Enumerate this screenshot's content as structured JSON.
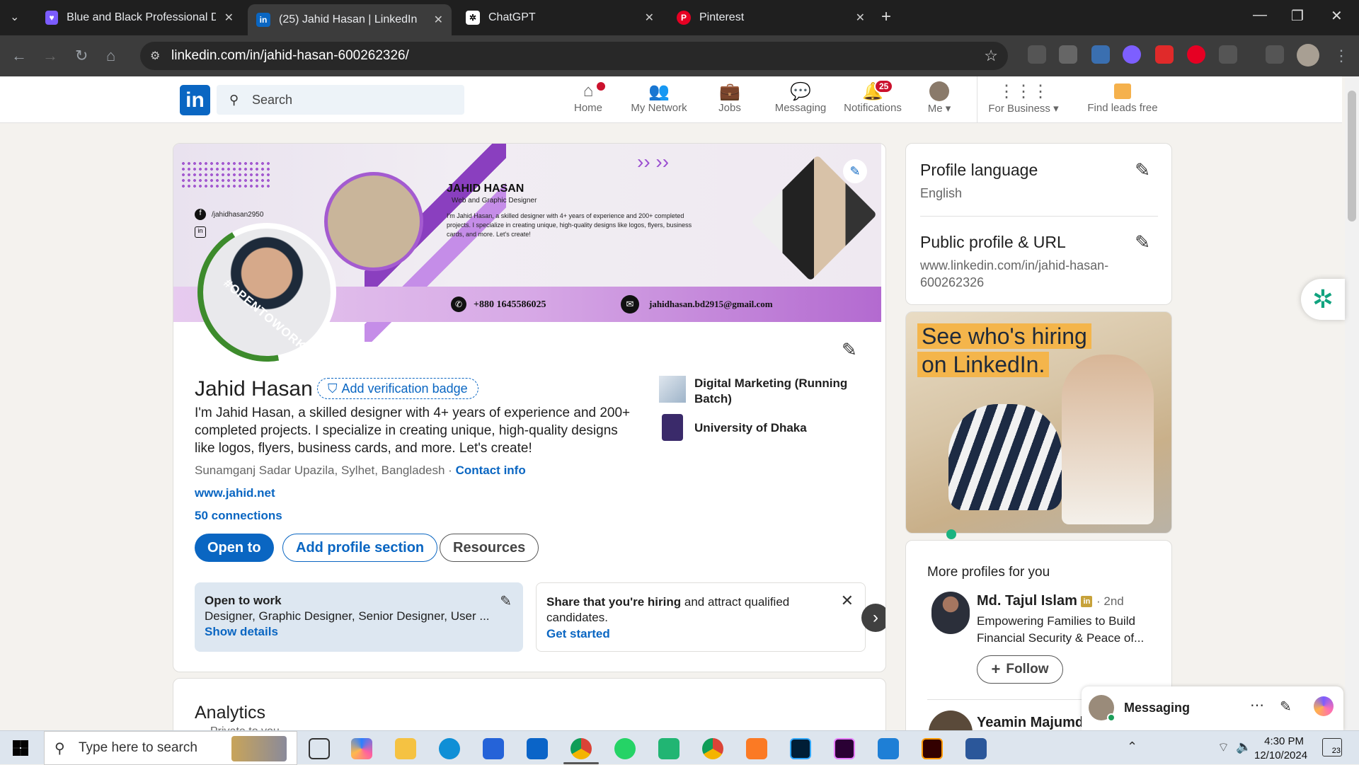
{
  "browser": {
    "tabs": [
      {
        "label": "Blue and Black Professional Doc",
        "icon": "canva-heart-icon"
      },
      {
        "label": "(25) Jahid Hasan | LinkedIn",
        "icon": "linkedin-icon"
      },
      {
        "label": "ChatGPT",
        "icon": "chatgpt-icon"
      },
      {
        "label": "Pinterest",
        "icon": "pinterest-icon"
      }
    ],
    "url": "linkedin.com/in/jahid-hasan-600262326/"
  },
  "header": {
    "search_placeholder": "Search",
    "nav": [
      "Home",
      "My Network",
      "Jobs",
      "Messaging",
      "Notifications",
      "Me",
      "For Business",
      "Find leads free"
    ],
    "notifications_count": "25"
  },
  "banner": {
    "name": "JAHID HASAN",
    "role": "Web and Graphic Designer",
    "blurb": "I'm Jahid Hasan, a skilled designer with 4+ years of experience and 200+ completed projects. I specialize in creating unique, high-quality designs like logos, flyers, business cards, and more. Let's create!",
    "fb": "/jahidhasan2950",
    "phone": "+880 1645586025",
    "email": "jahidhasan.bd2915@gmail.com",
    "opentowork": "#OPENTOWORK"
  },
  "profile": {
    "name": "Jahid Hasan",
    "verify": "Add verification badge",
    "headline": "I'm Jahid Hasan, a skilled designer with 4+ years of experience and 200+ completed projects. I specialize in creating unique, high-quality designs like logos, flyers, business cards, and more. Let's create!",
    "location": "Sunamganj Sadar Upazila, Sylhet, Bangladesh",
    "location_sep": " · ",
    "contact": "Contact info",
    "website": "www.jahid.net",
    "connections": "50 connections",
    "btn_open": "Open to",
    "btn_add": "Add profile section",
    "btn_resources": "Resources",
    "exp1": "Digital Marketing (Running Batch)",
    "exp2": "University of Dhaka"
  },
  "opentowork_card": {
    "title": "Open to work",
    "roles": "Designer, Graphic Designer, Senior Designer, User ...",
    "link": "Show details"
  },
  "hiring_card": {
    "bold": "Share that you're hiring",
    "rest": " and attract qualified candidates.",
    "link": "Get started"
  },
  "analytics": {
    "title": "Analytics",
    "sub": "Private to you"
  },
  "sidebar": {
    "lang_title": "Profile language",
    "lang_value": "English",
    "url_title": "Public profile & URL",
    "url_value": "www.linkedin.com/in/jahid-hasan-600262326",
    "ad_line1": "See who's hiring",
    "ad_line2": "on LinkedIn.",
    "more_title": "More profiles for you",
    "p1_name": "Md. Tajul Islam",
    "p1_degree": "· 2nd",
    "p1_desc": "Empowering Families to Build Financial Security & Peace of...",
    "follow": "Follow",
    "p2_name": "Yeamin Majumde"
  },
  "messaging": {
    "label": "Messaging"
  },
  "taskbar": {
    "search": "Type here to search",
    "time": "4:30 PM",
    "date": "12/10/2024",
    "notif": "23"
  }
}
